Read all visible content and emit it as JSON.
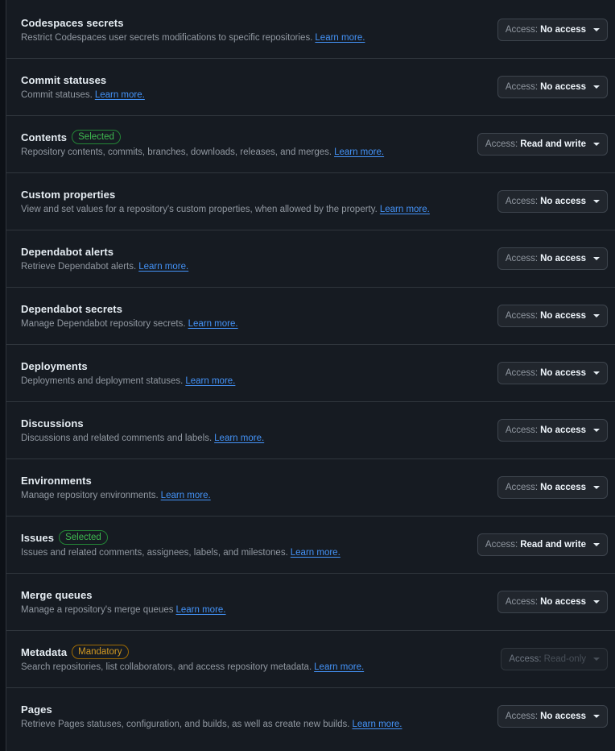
{
  "access_prefix": "Access:",
  "learn_more": "Learn more.",
  "rows": [
    {
      "title": "Codespaces secrets",
      "badge": "",
      "description": "Restrict Codespaces user secrets modifications to specific repositories.",
      "access": "No access"
    },
    {
      "title": "Commit statuses",
      "badge": "",
      "description": "Commit statuses.",
      "access": "No access"
    },
    {
      "title": "Contents",
      "badge": "Selected",
      "description": "Repository contents, commits, branches, downloads, releases, and merges.",
      "access": "Read and write"
    },
    {
      "title": "Custom properties",
      "badge": "",
      "description": "View and set values for a repository's custom properties, when allowed by the property.",
      "access": "No access"
    },
    {
      "title": "Dependabot alerts",
      "badge": "",
      "description": "Retrieve Dependabot alerts.",
      "access": "No access"
    },
    {
      "title": "Dependabot secrets",
      "badge": "",
      "description": "Manage Dependabot repository secrets.",
      "access": "No access"
    },
    {
      "title": "Deployments",
      "badge": "",
      "description": "Deployments and deployment statuses.",
      "access": "No access"
    },
    {
      "title": "Discussions",
      "badge": "",
      "description": "Discussions and related comments and labels.",
      "access": "No access"
    },
    {
      "title": "Environments",
      "badge": "",
      "description": "Manage repository environments.",
      "access": "No access"
    },
    {
      "title": "Issues",
      "badge": "Selected",
      "description": "Issues and related comments, assignees, labels, and milestones.",
      "access": "Read and write"
    },
    {
      "title": "Merge queues",
      "badge": "",
      "description": "Manage a repository's merge queues",
      "access": "No access"
    },
    {
      "title": "Metadata",
      "badge": "Mandatory",
      "description": "Search repositories, list collaborators, and access repository metadata.",
      "access": "Read-only"
    },
    {
      "title": "Pages",
      "badge": "",
      "description": "Retrieve Pages statuses, configuration, and builds, as well as create new builds.",
      "access": "No access"
    }
  ]
}
